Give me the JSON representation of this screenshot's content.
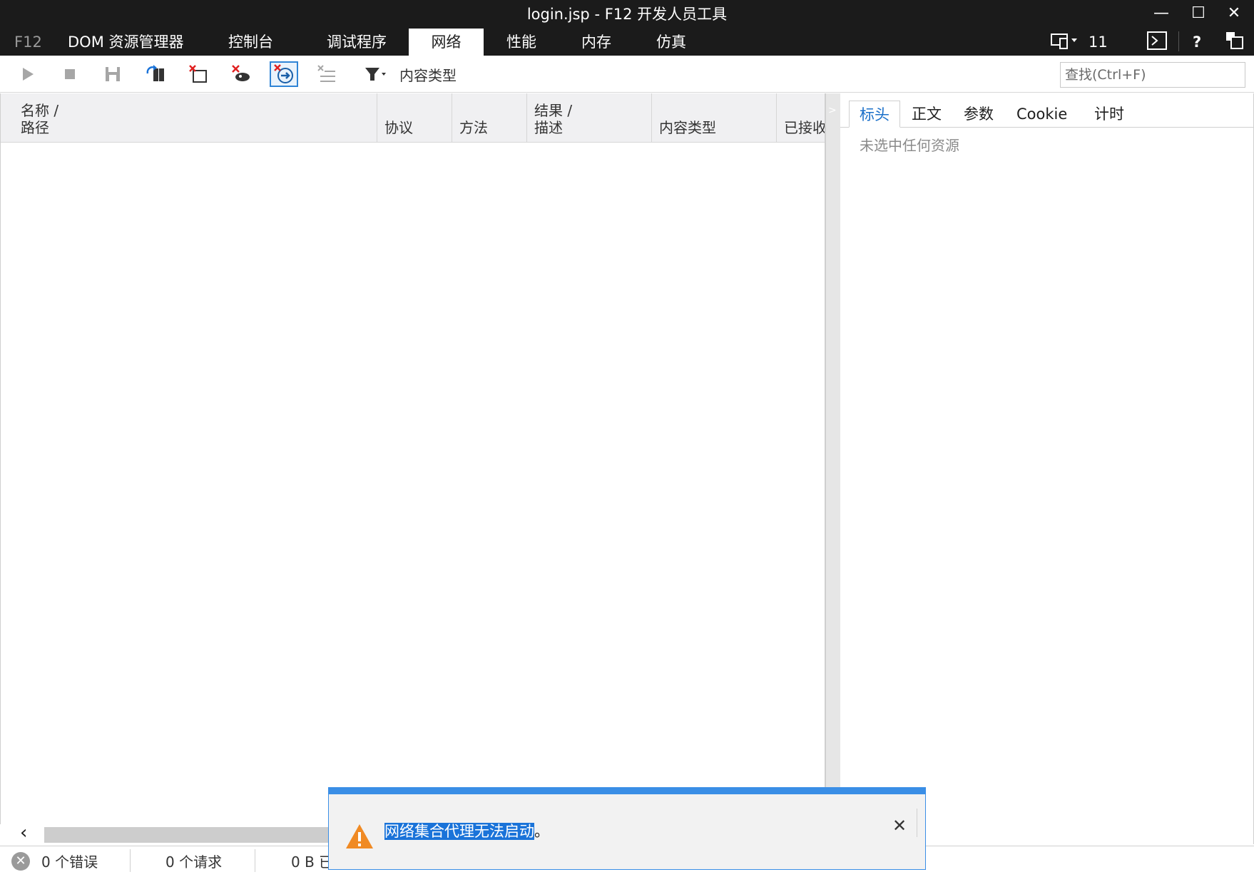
{
  "window": {
    "title": "login.jsp - F12 开发人员工具",
    "minimize": "—",
    "maximize": "☐",
    "close": "✕"
  },
  "tabs": [
    "F12",
    "DOM 资源管理器",
    "控制台",
    "调试程序",
    "网络",
    "性能",
    "内存",
    "仿真"
  ],
  "active_tab": "网络",
  "tab_icons": {
    "emulation_value": "11",
    "console_icon": ">_",
    "help": "?"
  },
  "toolbar": {
    "filter_label": "内容类型",
    "search_placeholder": "查找(Ctrl+F)"
  },
  "grid": {
    "columns": [
      {
        "line1": "名称 /",
        "line2": "路径"
      },
      {
        "line1": "",
        "line2": "协议"
      },
      {
        "line1": "",
        "line2": "方法"
      },
      {
        "line1": "结果 /",
        "line2": "描述"
      },
      {
        "line1": "",
        "line2": "内容类型"
      },
      {
        "line1": "",
        "line2": "已接收"
      }
    ]
  },
  "details": {
    "tabs": [
      "标头",
      "正文",
      "参数",
      "Cookie",
      "计时"
    ],
    "active_tab": "标头",
    "empty_message": "未选中任何资源"
  },
  "status": {
    "errors": "0 个错误",
    "requests": "0 个请求",
    "received": "0 B 已"
  },
  "notification": {
    "selected_text": "网络集合代理无法启动",
    "trailing_text": "。",
    "close": "✕"
  },
  "colors": {
    "titlebar": "#1b1b1b",
    "accent": "#3a8ee6",
    "warning": "#f08a24"
  }
}
